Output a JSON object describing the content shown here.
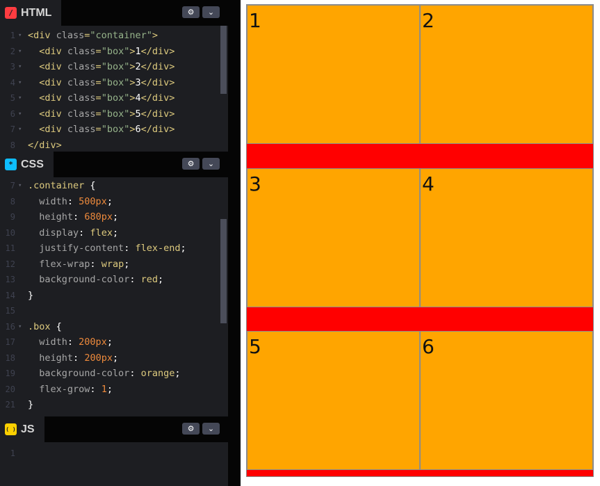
{
  "panels": {
    "html": {
      "tab_label": "HTML",
      "badge": "/",
      "badge_color": "#ff3c41",
      "lines": [
        {
          "n": "1",
          "fold": "▾",
          "parts": [
            [
              "tag",
              "<div "
            ],
            [
              "attr",
              "class"
            ],
            [
              "tag",
              "="
            ],
            [
              "str",
              "\"container\""
            ],
            [
              "tag",
              ">"
            ]
          ]
        },
        {
          "n": "2",
          "fold": "▾",
          "parts": [
            [
              "plain",
              "  "
            ],
            [
              "tag",
              "<div "
            ],
            [
              "attr",
              "class"
            ],
            [
              "tag",
              "="
            ],
            [
              "str",
              "\"box\""
            ],
            [
              "tag",
              ">"
            ],
            [
              "plain",
              "1"
            ],
            [
              "tag",
              "</div>"
            ]
          ]
        },
        {
          "n": "3",
          "fold": "▾",
          "parts": [
            [
              "plain",
              "  "
            ],
            [
              "tag",
              "<div "
            ],
            [
              "attr",
              "class"
            ],
            [
              "tag",
              "="
            ],
            [
              "str",
              "\"box\""
            ],
            [
              "tag",
              ">"
            ],
            [
              "plain",
              "2"
            ],
            [
              "tag",
              "</div>"
            ]
          ]
        },
        {
          "n": "4",
          "fold": "▾",
          "parts": [
            [
              "plain",
              "  "
            ],
            [
              "tag",
              "<div "
            ],
            [
              "attr",
              "class"
            ],
            [
              "tag",
              "="
            ],
            [
              "str",
              "\"box\""
            ],
            [
              "tag",
              ">"
            ],
            [
              "plain",
              "3"
            ],
            [
              "tag",
              "</div>"
            ]
          ]
        },
        {
          "n": "5",
          "fold": "▾",
          "parts": [
            [
              "plain",
              "  "
            ],
            [
              "tag",
              "<div "
            ],
            [
              "attr",
              "class"
            ],
            [
              "tag",
              "="
            ],
            [
              "str",
              "\"box\""
            ],
            [
              "tag",
              ">"
            ],
            [
              "plain",
              "4"
            ],
            [
              "tag",
              "</div>"
            ]
          ]
        },
        {
          "n": "6",
          "fold": "▾",
          "parts": [
            [
              "plain",
              "  "
            ],
            [
              "tag",
              "<div "
            ],
            [
              "attr",
              "class"
            ],
            [
              "tag",
              "="
            ],
            [
              "str",
              "\"box\""
            ],
            [
              "tag",
              ">"
            ],
            [
              "plain",
              "5"
            ],
            [
              "tag",
              "</div>"
            ]
          ]
        },
        {
          "n": "7",
          "fold": "▾",
          "parts": [
            [
              "plain",
              "  "
            ],
            [
              "tag",
              "<div "
            ],
            [
              "attr",
              "class"
            ],
            [
              "tag",
              "="
            ],
            [
              "str",
              "\"box\""
            ],
            [
              "tag",
              ">"
            ],
            [
              "plain",
              "6"
            ],
            [
              "tag",
              "</div>"
            ]
          ]
        },
        {
          "n": "8",
          "fold": "",
          "parts": [
            [
              "tag",
              "</div>"
            ]
          ]
        }
      ]
    },
    "css": {
      "tab_label": "CSS",
      "badge": "*",
      "badge_color": "#0ebeff",
      "lines": [
        {
          "n": "7",
          "fold": "▾",
          "parts": [
            [
              "sel",
              ".container "
            ],
            [
              "plain",
              "{"
            ]
          ]
        },
        {
          "n": "8",
          "fold": "",
          "parts": [
            [
              "plain",
              "  "
            ],
            [
              "prop",
              "width"
            ],
            [
              "plain",
              ": "
            ],
            [
              "num",
              "500px"
            ],
            [
              "plain",
              ";"
            ]
          ]
        },
        {
          "n": "9",
          "fold": "",
          "parts": [
            [
              "plain",
              "  "
            ],
            [
              "prop",
              "height"
            ],
            [
              "plain",
              ": "
            ],
            [
              "num",
              "680px"
            ],
            [
              "plain",
              ";"
            ]
          ]
        },
        {
          "n": "10",
          "fold": "",
          "parts": [
            [
              "plain",
              "  "
            ],
            [
              "prop",
              "display"
            ],
            [
              "plain",
              ": "
            ],
            [
              "kw",
              "flex"
            ],
            [
              "plain",
              ";"
            ]
          ]
        },
        {
          "n": "11",
          "fold": "",
          "parts": [
            [
              "plain",
              "  "
            ],
            [
              "prop",
              "justify-content"
            ],
            [
              "plain",
              ": "
            ],
            [
              "kw",
              "flex-end"
            ],
            [
              "plain",
              ";"
            ]
          ]
        },
        {
          "n": "12",
          "fold": "",
          "parts": [
            [
              "plain",
              "  "
            ],
            [
              "prop",
              "flex-wrap"
            ],
            [
              "plain",
              ": "
            ],
            [
              "kw",
              "wrap"
            ],
            [
              "plain",
              ";"
            ]
          ]
        },
        {
          "n": "13",
          "fold": "",
          "parts": [
            [
              "plain",
              "  "
            ],
            [
              "prop",
              "background-color"
            ],
            [
              "plain",
              ": "
            ],
            [
              "kw",
              "red"
            ],
            [
              "plain",
              ";"
            ]
          ]
        },
        {
          "n": "14",
          "fold": "",
          "parts": [
            [
              "plain",
              "}"
            ]
          ]
        },
        {
          "n": "15",
          "fold": "",
          "parts": []
        },
        {
          "n": "16",
          "fold": "▾",
          "parts": [
            [
              "sel",
              ".box "
            ],
            [
              "plain",
              "{"
            ]
          ]
        },
        {
          "n": "17",
          "fold": "",
          "parts": [
            [
              "plain",
              "  "
            ],
            [
              "prop",
              "width"
            ],
            [
              "plain",
              ": "
            ],
            [
              "num",
              "200px"
            ],
            [
              "plain",
              ";"
            ]
          ]
        },
        {
          "n": "18",
          "fold": "",
          "parts": [
            [
              "plain",
              "  "
            ],
            [
              "prop",
              "height"
            ],
            [
              "plain",
              ": "
            ],
            [
              "num",
              "200px"
            ],
            [
              "plain",
              ";"
            ]
          ]
        },
        {
          "n": "19",
          "fold": "",
          "parts": [
            [
              "plain",
              "  "
            ],
            [
              "prop",
              "background-color"
            ],
            [
              "plain",
              ": "
            ],
            [
              "kw",
              "orange"
            ],
            [
              "plain",
              ";"
            ]
          ]
        },
        {
          "n": "20",
          "fold": "",
          "parts": [
            [
              "plain",
              "  "
            ],
            [
              "prop",
              "flex-grow"
            ],
            [
              "plain",
              ": "
            ],
            [
              "num",
              "1"
            ],
            [
              "plain",
              ";"
            ]
          ]
        },
        {
          "n": "21",
          "fold": "",
          "parts": [
            [
              "plain",
              "}"
            ]
          ]
        }
      ]
    },
    "js": {
      "tab_label": "JS",
      "badge": "( )",
      "badge_color": "#fcd000",
      "lines": [
        {
          "n": "1",
          "fold": "",
          "parts": []
        }
      ]
    }
  },
  "header_buttons": {
    "settings_icon": "gear-icon",
    "collapse_icon": "chevron-down-icon"
  },
  "preview": {
    "boxes": [
      "1",
      "2",
      "3",
      "4",
      "5",
      "6"
    ],
    "container_color": "#ff0000",
    "box_color": "#ffa500"
  }
}
